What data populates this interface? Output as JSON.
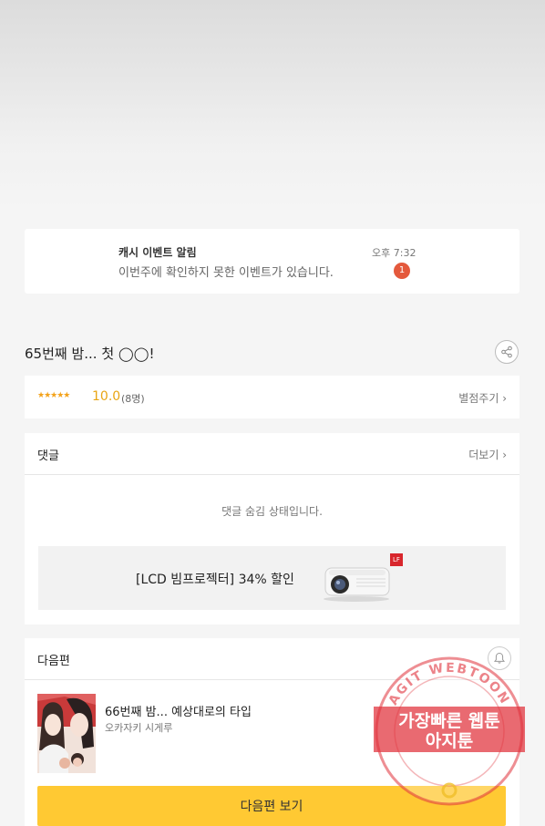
{
  "notification": {
    "title": "캐시 이벤트 알림",
    "message": "이번주에 확인하지 못한 이벤트가 있습니다.",
    "time": "오후 7:32",
    "badge": "1"
  },
  "episode": {
    "title": "65번째 밤... 첫 ◯◯!",
    "share_icon": "share-icon"
  },
  "rating": {
    "stars": "★★★★★",
    "score": "10.0",
    "count": "(8명)",
    "action": "별점주기 ›"
  },
  "comments": {
    "title": "댓글",
    "more": "더보기 ›",
    "hidden_message": "댓글 숨김 상태입니다."
  },
  "ad": {
    "text": "[LCD 빔프로젝터] 34% 할인",
    "badge": "LF"
  },
  "next_episode": {
    "header": "다음편",
    "bell_icon": "bell-icon",
    "title": "66번째 밤... 예상대로의 타입",
    "author": "오카자키 시게루",
    "button": "다음편 보기"
  },
  "watermark": {
    "ring_text": "AGIT WEBTOON",
    "line1": "가장빠른 웹툰",
    "line2": "아지툰"
  },
  "colors": {
    "accent_yellow": "#ffc933",
    "badge_red": "#e4593c",
    "star_orange": "#f3a21a",
    "watermark_red": "#e0313a"
  }
}
